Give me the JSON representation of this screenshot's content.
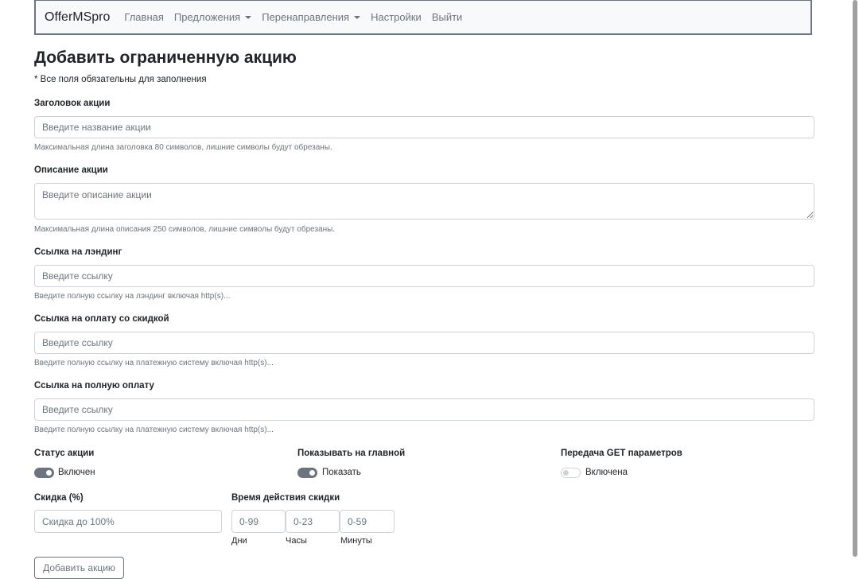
{
  "nav": {
    "brand": "OfferMSpro",
    "items": [
      {
        "label": "Главная"
      },
      {
        "label": "Предложения"
      },
      {
        "label": "Перенаправления"
      },
      {
        "label": "Настройки"
      },
      {
        "label": "Выйти"
      }
    ]
  },
  "page": {
    "title": "Добавить ограниченную акцию",
    "required_note": "* Все поля обязательны для заполнения"
  },
  "form": {
    "title": {
      "label": "Заголовок акции",
      "placeholder": "Введите название акции",
      "help": "Максимальная длина заголовка 80 символов, лишние символы будут обрезаны."
    },
    "description": {
      "label": "Описание акции",
      "placeholder": "Введите описание акции",
      "help": "Максимальная длина описания 250 символов, лишние символы будут обрезаны."
    },
    "landing": {
      "label": "Ссылка на лэндинг",
      "placeholder": "Введите ссылку",
      "help": "Введите полную ссылку на лэндинг включая http(s)..."
    },
    "discount_pay": {
      "label": "Ссылка на оплату со скидкой",
      "placeholder": "Введите ссылку",
      "help": "Введите полную ссылку на платежную систему включая http(s)..."
    },
    "full_pay": {
      "label": "Ссылка на полную оплату",
      "placeholder": "Введите ссылку",
      "help": "Введите полную ссылку на платежную систему включая http(s)..."
    },
    "status": {
      "label": "Статус акции",
      "switch_label": "Включен",
      "on": true
    },
    "show_main": {
      "label": "Показывать на главной",
      "switch_label": "Показать",
      "on": true
    },
    "get_params": {
      "label": "Передача GET параметров",
      "switch_label": "Включена",
      "on": false
    },
    "discount": {
      "label": "Скидка (%)",
      "placeholder": "Скидка до 100%"
    },
    "duration": {
      "label": "Время действия скидки",
      "days": {
        "placeholder": "0-99",
        "caption": "Дни"
      },
      "hours": {
        "placeholder": "0-23",
        "caption": "Часы"
      },
      "minutes": {
        "placeholder": "0-59",
        "caption": "Минуты"
      }
    },
    "submit_label": "Добавить акцию"
  },
  "colors": {
    "accent": "#6c757d",
    "border": "#ced4da",
    "nav_bg": "#f8f9fa"
  }
}
